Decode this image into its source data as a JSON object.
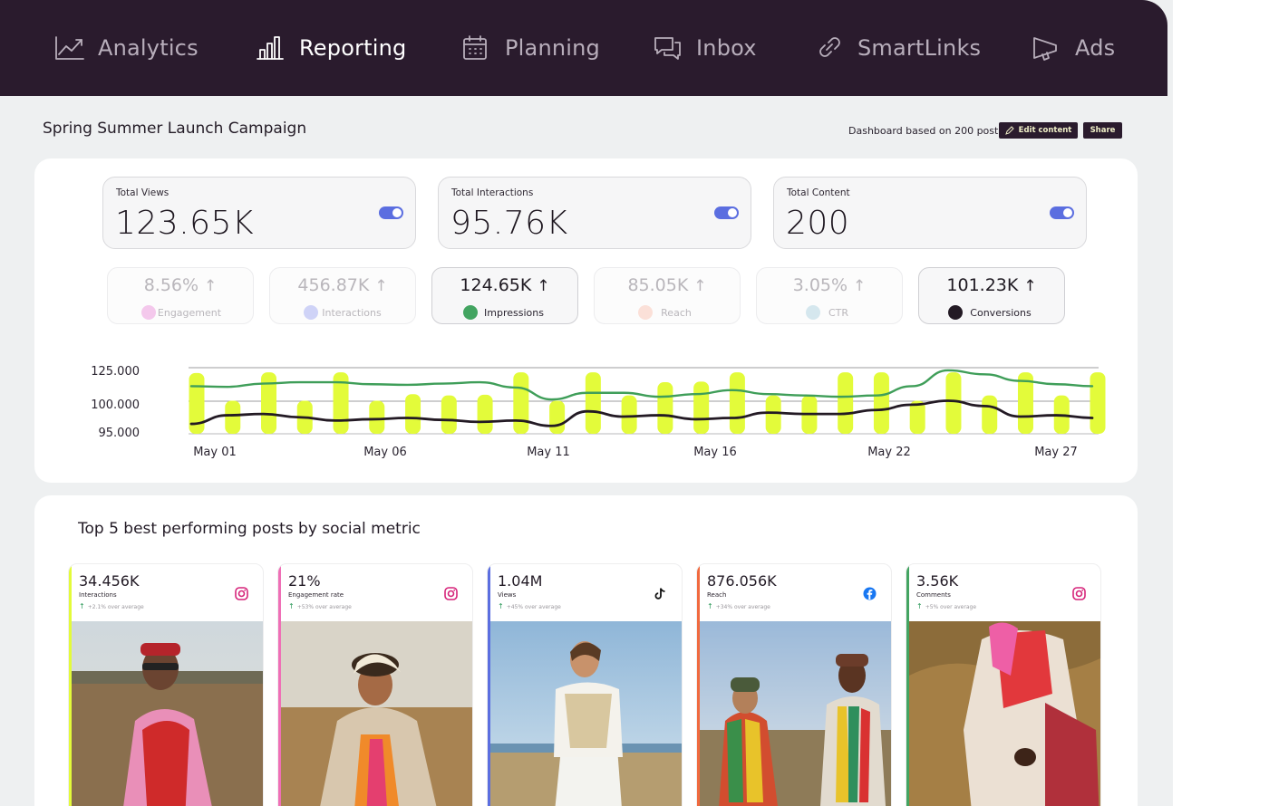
{
  "nav": {
    "items": [
      {
        "label": "Analytics",
        "icon": "line-chart-icon",
        "active": false
      },
      {
        "label": "Reporting",
        "icon": "bar-chart-icon",
        "active": true
      },
      {
        "label": "Planning",
        "icon": "calendar-icon",
        "active": false
      },
      {
        "label": "Inbox",
        "icon": "chat-icon",
        "active": false
      },
      {
        "label": "SmartLinks",
        "icon": "link-icon",
        "active": false
      },
      {
        "label": "Ads",
        "icon": "megaphone-icon",
        "active": false
      }
    ]
  },
  "header": {
    "title": "Spring Summer Launch Campaign",
    "dashboard_info": "Dashboard based on 200 posts",
    "edit_label": "Edit content",
    "share_label": "Share"
  },
  "kpis": [
    {
      "label": "Total Views",
      "value": "123.65K",
      "toggle_on": true
    },
    {
      "label": "Total Interactions",
      "value": "95.76K",
      "toggle_on": true
    },
    {
      "label": "Total Content",
      "value": "200",
      "toggle_on": true
    }
  ],
  "metrics": [
    {
      "value": "8.56%",
      "label": "Engagement",
      "dot": "#f4c8ec",
      "active": false
    },
    {
      "value": "456.87K",
      "label": "Interactions",
      "dot": "#cfd3f7",
      "active": false
    },
    {
      "value": "124.65K",
      "label": "Impressions",
      "dot": "#43a461",
      "active": true
    },
    {
      "value": "85.05K",
      "label": "Reach",
      "dot": "#fbe0d8",
      "active": false
    },
    {
      "value": "3.05%",
      "label": "CTR",
      "dot": "#d5e7ee",
      "active": false
    },
    {
      "value": "101.23K",
      "label": "Conversions",
      "dot": "#231a24",
      "active": true
    }
  ],
  "chart_data": {
    "type": "bar",
    "y_ticks": [
      "125.000",
      "100.000",
      "95.000"
    ],
    "x_ticks": [
      "May 01",
      "May 06",
      "May 11",
      "May 16",
      "May 22",
      "May 27"
    ],
    "bar_color": "#e3fb3a",
    "bars": [
      0.92,
      0.5,
      0.93,
      0.5,
      0.93,
      0.5,
      0.6,
      0.58,
      0.59,
      0.93,
      0.5,
      0.93,
      0.58,
      0.78,
      0.79,
      0.93,
      0.58,
      0.58,
      0.93,
      0.93,
      0.5,
      0.93,
      0.58,
      0.93,
      0.58,
      0.93
    ],
    "series": [
      {
        "color": "#3f9e59",
        "values": [
          0.72,
          0.71,
          0.76,
          0.78,
          0.78,
          0.75,
          0.74,
          0.76,
          0.78,
          0.7,
          0.52,
          0.62,
          0.62,
          0.56,
          0.6,
          0.66,
          0.6,
          0.58,
          0.56,
          0.58,
          0.72,
          0.96,
          0.9,
          0.8,
          0.75,
          0.72
        ]
      },
      {
        "color": "#231a24",
        "values": [
          0.15,
          0.28,
          0.3,
          0.25,
          0.2,
          0.22,
          0.24,
          0.21,
          0.18,
          0.2,
          0.12,
          0.34,
          0.26,
          0.28,
          0.22,
          0.24,
          0.32,
          0.3,
          0.3,
          0.36,
          0.44,
          0.5,
          0.42,
          0.26,
          0.28,
          0.24
        ]
      }
    ]
  },
  "top_posts": {
    "title": "Top 5 best performing posts by social metric",
    "posts": [
      {
        "value": "34.456K",
        "metric": "Interactions",
        "avg": "+2.1% over average",
        "platform": "instagram",
        "stripe": "#e3fb3a"
      },
      {
        "value": "21%",
        "metric": "Engagement rate",
        "avg": "+53% over average",
        "platform": "instagram",
        "stripe": "#ef6fb6"
      },
      {
        "value": "1.04M",
        "metric": "Views",
        "avg": "+45% over average",
        "platform": "tiktok",
        "stripe": "#5b6ee0"
      },
      {
        "value": "876.056K",
        "metric": "Reach",
        "avg": "+34% over average",
        "platform": "facebook",
        "stripe": "#f16a3f"
      },
      {
        "value": "3.56K",
        "metric": "Comments",
        "avg": "+5% over average",
        "platform": "instagram",
        "stripe": "#43a461"
      }
    ]
  }
}
